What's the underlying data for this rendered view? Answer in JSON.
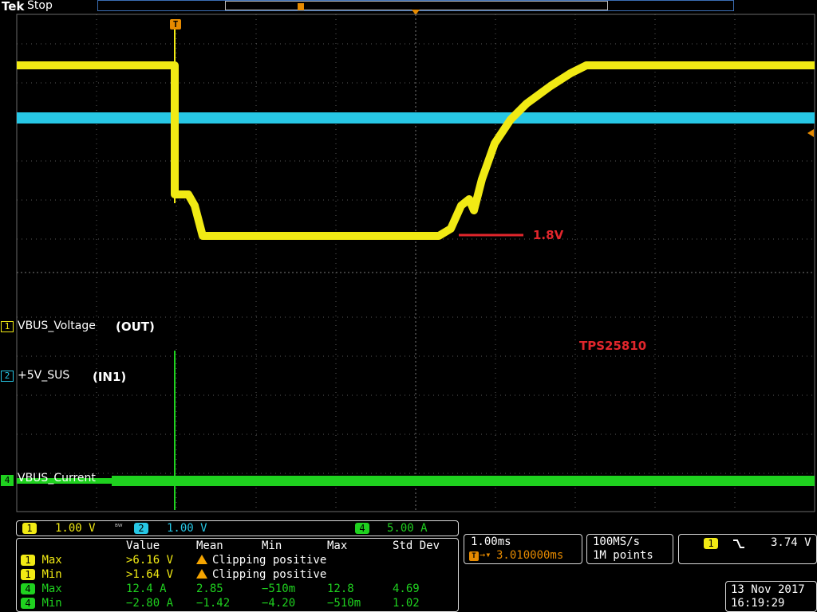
{
  "header": {
    "brand": "Tek",
    "status": "Stop",
    "trigger_marker": "T"
  },
  "colors": {
    "ch1": "#f1ea14",
    "ch2": "#27c7e5",
    "ch4": "#1fd11f",
    "annotation": "#e1262c",
    "grid": "#5a5a5a"
  },
  "channels": [
    {
      "num": "1",
      "name": "VBUS_Voltage",
      "note": "(OUT)"
    },
    {
      "num": "2",
      "name": "+5V_SUS",
      "note": "(IN1)"
    },
    {
      "num": "4",
      "name": "VBUS_Current"
    }
  ],
  "annotations": {
    "level": "1.8V",
    "part": "TPS25810"
  },
  "scales": {
    "ch1": "1.00 V",
    "bw_icon": "bw-limit-icon",
    "ch2": "1.00 V",
    "ch4": "5.00 A"
  },
  "measurements": {
    "headers": [
      "Value",
      "Mean",
      "Min",
      "Max",
      "Std Dev"
    ],
    "rows": [
      {
        "ch": "1",
        "label": "Max",
        "value": ">6.16 V",
        "warning": "Clipping positive"
      },
      {
        "ch": "1",
        "label": "Min",
        "value": ">1.64 V",
        "warning": "Clipping positive"
      },
      {
        "ch": "4",
        "label": "Max",
        "value": "12.4 A",
        "mean": "2.85",
        "min": "−510m",
        "max": "12.8",
        "std": "4.69"
      },
      {
        "ch": "4",
        "label": "Min",
        "value": "−2.80 A",
        "mean": "−1.42",
        "min": "−4.20",
        "max": "−510m",
        "std": "1.02"
      }
    ]
  },
  "horizontal": {
    "scale": "1.00ms",
    "trigger_symbol": "T→",
    "position": "3.010000ms"
  },
  "acquisition": {
    "rate": "100MS/s",
    "points": "1M points"
  },
  "trigger": {
    "channel": "1",
    "slope_icon": "falling-edge-icon",
    "level": "3.74 V"
  },
  "datetime": {
    "date": "13 Nov 2017",
    "time": "16:19:29"
  }
}
